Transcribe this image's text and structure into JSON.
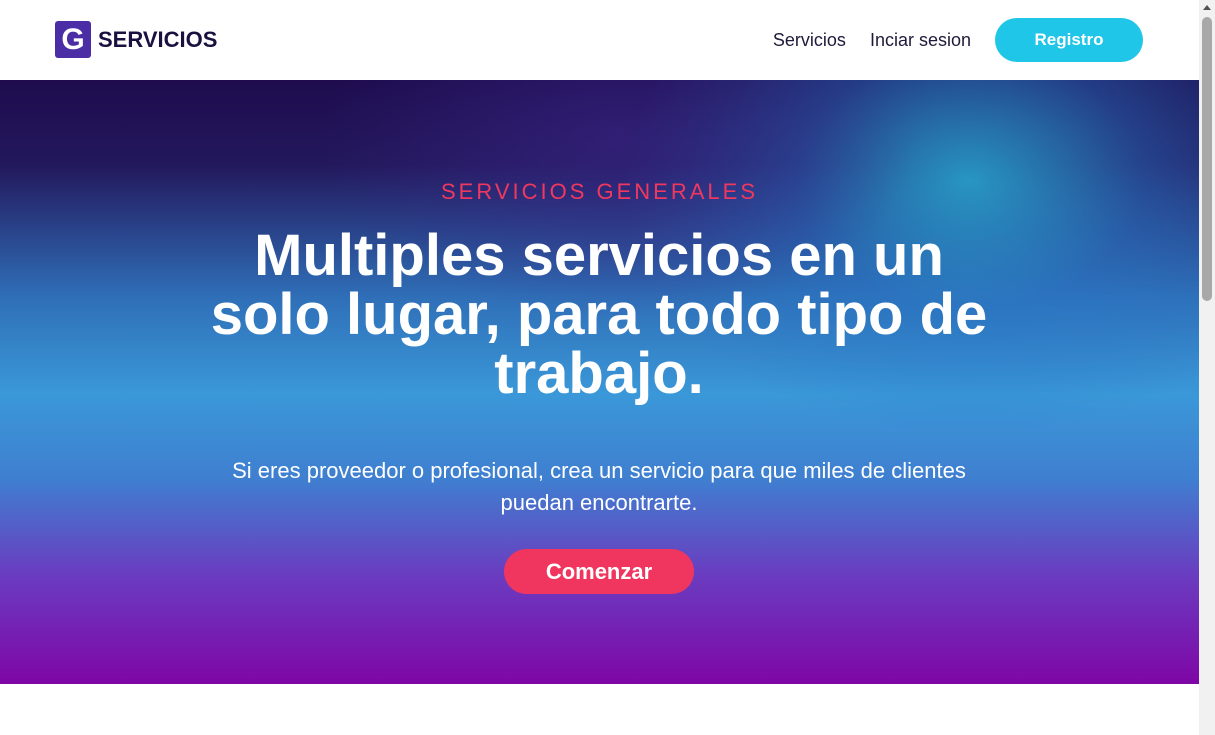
{
  "navbar": {
    "logo_letter": "G",
    "brand_name": "SERVICIOS",
    "links": [
      {
        "label": "Servicios"
      },
      {
        "label": "Inciar sesion"
      }
    ],
    "cta_label": "Registro"
  },
  "hero": {
    "eyebrow": "SERVICIOS GENERALES",
    "title": "Multiples servicios en un solo lugar, para todo tipo de trabajo.",
    "subtitle": "Si eres proveedor o profesional, crea un servicio para que miles de clientes puedan encontrarte.",
    "cta_label": "Comenzar"
  },
  "colors": {
    "brand": "#4b2ea6",
    "accent_cyan": "#20c6e8",
    "accent_pink": "#f0365f"
  }
}
